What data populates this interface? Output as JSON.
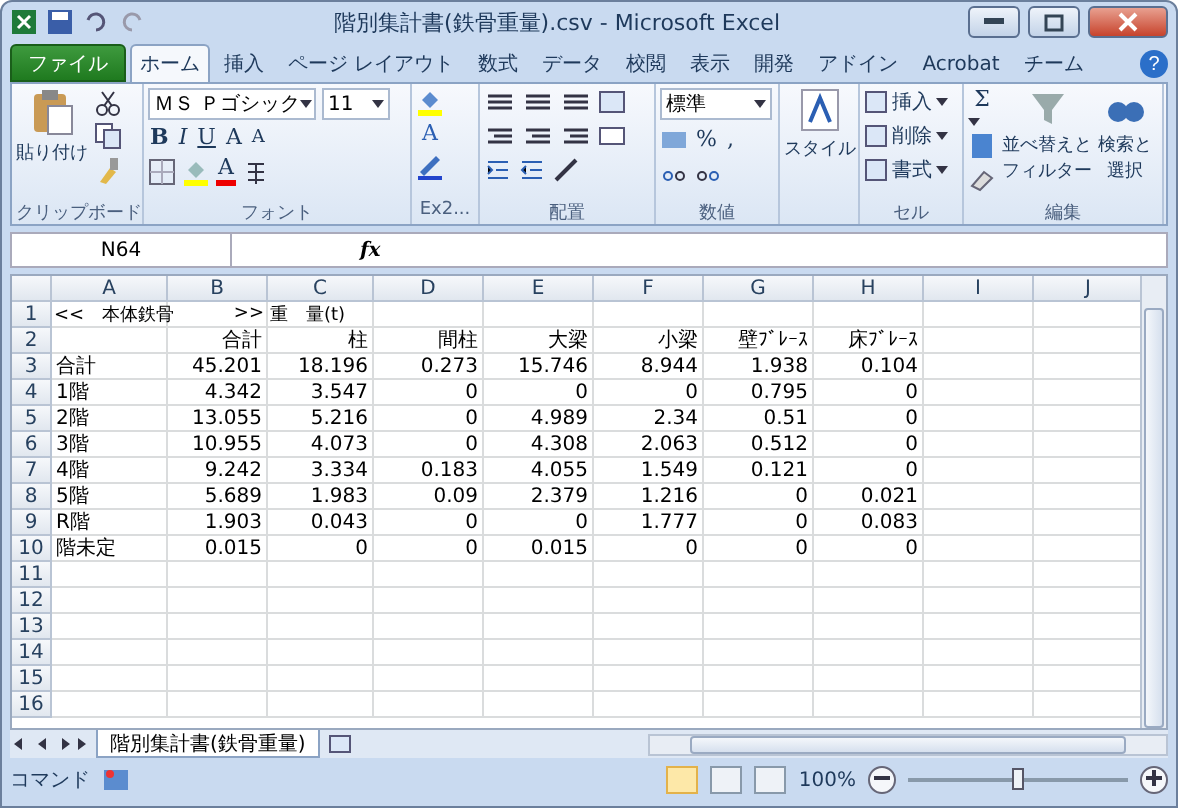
{
  "window": {
    "title": "階別集計書(鉄骨重量).csv - Microsoft Excel"
  },
  "file_tab": "ファイル",
  "tabs": [
    {
      "label": "ホーム",
      "selected": true
    },
    {
      "label": "挿入",
      "selected": false
    },
    {
      "label": "ページ レイアウト",
      "selected": false
    },
    {
      "label": "数式",
      "selected": false
    },
    {
      "label": "データ",
      "selected": false
    },
    {
      "label": "校閲",
      "selected": false
    },
    {
      "label": "表示",
      "selected": false
    },
    {
      "label": "開発",
      "selected": false
    },
    {
      "label": "アドイン",
      "selected": false
    },
    {
      "label": "Acrobat",
      "selected": false
    },
    {
      "label": "チーム",
      "selected": false
    }
  ],
  "help": "?",
  "ribbon": [
    {
      "kind": "clipboard",
      "label": "クリップボード",
      "button": "貼り付け"
    },
    {
      "kind": "font",
      "label": "フォント",
      "font_name": "ＭＳ Ｐゴシック",
      "font_size": "11",
      "bold": "B",
      "italic": "I",
      "underline": "U",
      "grow": "A",
      "shrink": "A",
      "font_color": "A"
    },
    {
      "kind": "ex",
      "label": "Ex2...",
      "glyph": "A"
    },
    {
      "kind": "align",
      "label": "配置"
    },
    {
      "kind": "number",
      "label": "数値",
      "format": "標準",
      "percent": "%",
      "comma": ","
    },
    {
      "kind": "style",
      "button": "スタイル"
    },
    {
      "kind": "cells",
      "label": "セル",
      "buttons": [
        "挿入",
        "削除",
        "書式"
      ]
    },
    {
      "kind": "edit",
      "label": "編集",
      "sum": "Σ",
      "buttons": [
        "並べ替えと",
        "フィルター",
        "検索と",
        "選択"
      ]
    }
  ],
  "name_box": "N64",
  "formula_label": "fx",
  "columns": [
    "A",
    "B",
    "C",
    "D",
    "E",
    "F",
    "G",
    "H",
    "I",
    "J"
  ],
  "rows": [
    {
      "number": "1",
      "kind": "title",
      "cells": [
        "<<　本体鉄骨",
        ">>",
        "重　量(t)"
      ]
    },
    {
      "number": "2",
      "kind": "header",
      "cells": [
        "",
        "合計",
        "柱",
        "間柱",
        "大梁",
        "小梁",
        "壁ﾌﾞﾚｰｽ",
        "床ﾌﾞﾚｰｽ"
      ]
    },
    {
      "number": "3",
      "kind": "data",
      "cells": [
        "合計",
        "45.201",
        "18.196",
        "0.273",
        "15.746",
        "8.944",
        "1.938",
        "0.104"
      ]
    },
    {
      "number": "4",
      "kind": "data",
      "cells": [
        "1階",
        "4.342",
        "3.547",
        "0",
        "0",
        "0",
        "0.795",
        "0"
      ]
    },
    {
      "number": "5",
      "kind": "data",
      "cells": [
        "2階",
        "13.055",
        "5.216",
        "0",
        "4.989",
        "2.34",
        "0.51",
        "0"
      ]
    },
    {
      "number": "6",
      "kind": "data",
      "cells": [
        "3階",
        "10.955",
        "4.073",
        "0",
        "4.308",
        "2.063",
        "0.512",
        "0"
      ]
    },
    {
      "number": "7",
      "kind": "data",
      "cells": [
        "4階",
        "9.242",
        "3.334",
        "0.183",
        "4.055",
        "1.549",
        "0.121",
        "0"
      ]
    },
    {
      "number": "8",
      "kind": "data",
      "cells": [
        "5階",
        "5.689",
        "1.983",
        "0.09",
        "2.379",
        "1.216",
        "0",
        "0.021"
      ]
    },
    {
      "number": "9",
      "kind": "data",
      "cells": [
        "R階",
        "1.903",
        "0.043",
        "0",
        "0",
        "1.777",
        "0",
        "0.083"
      ]
    },
    {
      "number": "10",
      "kind": "data",
      "cells": [
        "階未定",
        "0.015",
        "0",
        "0",
        "0.015",
        "0",
        "0",
        "0"
      ]
    },
    {
      "number": "11",
      "kind": "data",
      "cells": []
    },
    {
      "number": "12",
      "kind": "data",
      "cells": []
    },
    {
      "number": "13",
      "kind": "data",
      "cells": []
    },
    {
      "number": "14",
      "kind": "data",
      "cells": []
    },
    {
      "number": "15",
      "kind": "data",
      "cells": []
    },
    {
      "number": "16",
      "kind": "data",
      "cells": []
    }
  ],
  "sheet_tabs": [
    {
      "label": "階別集計書(鉄骨重量)",
      "selected": true
    }
  ],
  "status": {
    "mode": "コマンド",
    "zoom": "100%",
    "zoom_slider": {
      "level": 0.5
    }
  }
}
